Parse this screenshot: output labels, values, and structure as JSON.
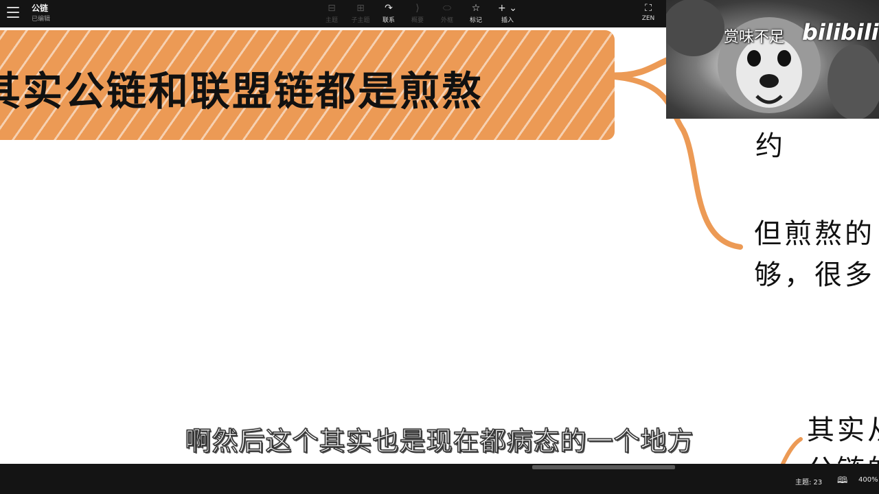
{
  "toolbar": {
    "doc_title": "公链",
    "doc_status": "已编辑",
    "tools": [
      {
        "label": "主题",
        "icon": "topic-icon",
        "glyph": "⊟",
        "enabled": false
      },
      {
        "label": "子主题",
        "icon": "subtopic-icon",
        "glyph": "⊞",
        "enabled": false
      },
      {
        "label": "联系",
        "icon": "relationship-icon",
        "glyph": "↷",
        "enabled": true
      },
      {
        "label": "概要",
        "icon": "summary-icon",
        "glyph": "⟩",
        "enabled": false
      },
      {
        "label": "外框",
        "icon": "boundary-icon",
        "glyph": "⬭",
        "enabled": false
      },
      {
        "label": "标记",
        "icon": "star-icon",
        "glyph": "☆",
        "enabled": true
      },
      {
        "label": "插入",
        "icon": "plus-icon",
        "glyph": "+ ⌄",
        "enabled": true
      }
    ],
    "zen_label": "ZEN",
    "zen_glyph": "⛶"
  },
  "mindmap": {
    "main_topic": "其实公链和联盟链都是煎熬",
    "branch_color": "#ec9a55",
    "nodes": [
      {
        "text_line1": "约"
      },
      {
        "text_line1": "但煎熬的",
        "text_line2": "够，很多"
      },
      {
        "text_line1": "其实从",
        "text_line2": "公链的"
      }
    ]
  },
  "video": {
    "watermark": "赏味不足",
    "logo": "bilibili"
  },
  "subtitle": "啊然后这个其实也是现在都病态的一个地方",
  "statusbar": {
    "topic_count": "主题: 23",
    "zoom": "400%"
  }
}
